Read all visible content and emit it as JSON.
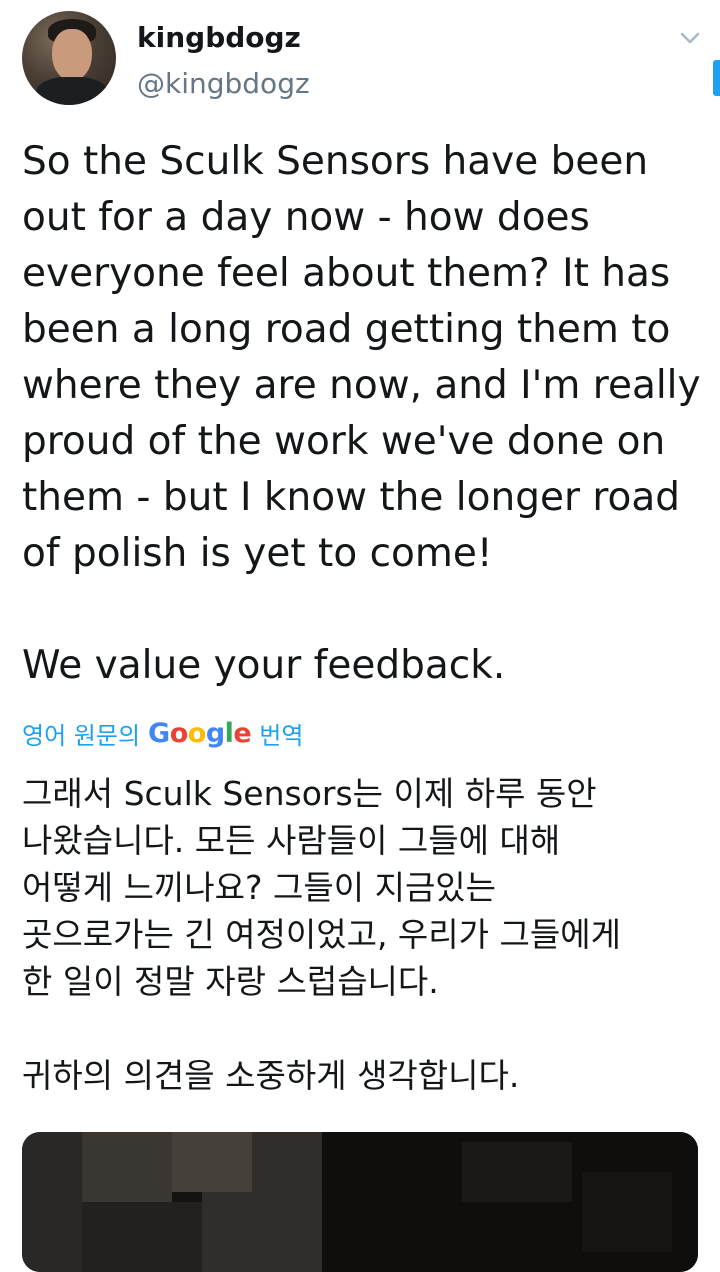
{
  "author": {
    "display_name": "kingbdogz",
    "handle": "@kingbdogz"
  },
  "tweet": {
    "lines": [
      "So the Sculk Sensors have been",
      "out for a day now - how does",
      "everyone feel about them? It has",
      "been a long road getting them to",
      "where they are now, and I'm really",
      "proud of the work we've done on",
      "them - but I know the longer road",
      "of polish is yet to come!"
    ],
    "closing": "We value your feedback."
  },
  "translation": {
    "prefix": "영어 원문의",
    "suffix": "번역",
    "lines": [
      "그래서 Sculk Sensors는 이제 하루 동안",
      "나왔습니다. 모든 사람들이 그들에 대해",
      "어떻게 느끼나요? 그들이 지금있는",
      "곳으로가는 긴 여정이었고, 우리가 그들에게",
      "한 일이 정말 자랑 스럽습니다."
    ],
    "closing": " 귀하의 의견을 소중하게 생각합니다."
  },
  "colors": {
    "link": "#1da1f2",
    "text": "#14171a",
    "muted": "#657786"
  },
  "icons": {
    "menu": "chevron-down-icon"
  }
}
